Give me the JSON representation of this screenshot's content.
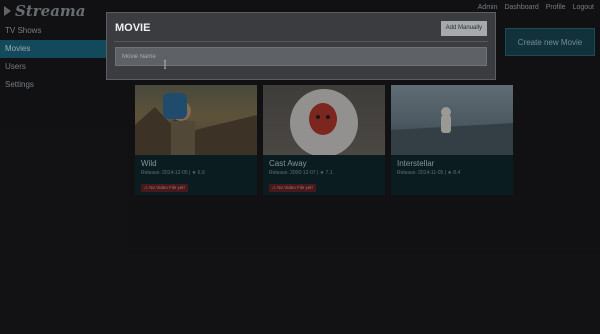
{
  "app": {
    "logo_text": "Streama"
  },
  "topnav": {
    "items": [
      "Admin",
      "Dashboard",
      "Profile",
      "Logout"
    ]
  },
  "sidebar": {
    "items": [
      {
        "label": "TV Shows",
        "active": false
      },
      {
        "label": "Movies",
        "active": true
      },
      {
        "label": "Users",
        "active": false
      },
      {
        "label": "Settings",
        "active": false
      }
    ]
  },
  "main": {
    "create_button": "Create new Movie"
  },
  "movies": [
    {
      "title": "Wild",
      "meta": "Release: 2014-12-05 | ★ 6.9",
      "badge": "⚠ No Video File yet!"
    },
    {
      "title": "Cast Away",
      "meta": "Release: 2000-12-07 | ★ 7.1",
      "badge": "⚠ No Video File yet!"
    },
    {
      "title": "Interstellar",
      "meta": "Release: 2014-11-05 | ★ 8.4",
      "badge": ""
    }
  ],
  "modal": {
    "title": "MOVIE",
    "add_manually": "Add Manually",
    "input_placeholder": "Movie Name"
  },
  "colors": {
    "accent": "#1b6e86",
    "badge_bg": "#6b2528",
    "card_bg": "#0f2a30"
  }
}
